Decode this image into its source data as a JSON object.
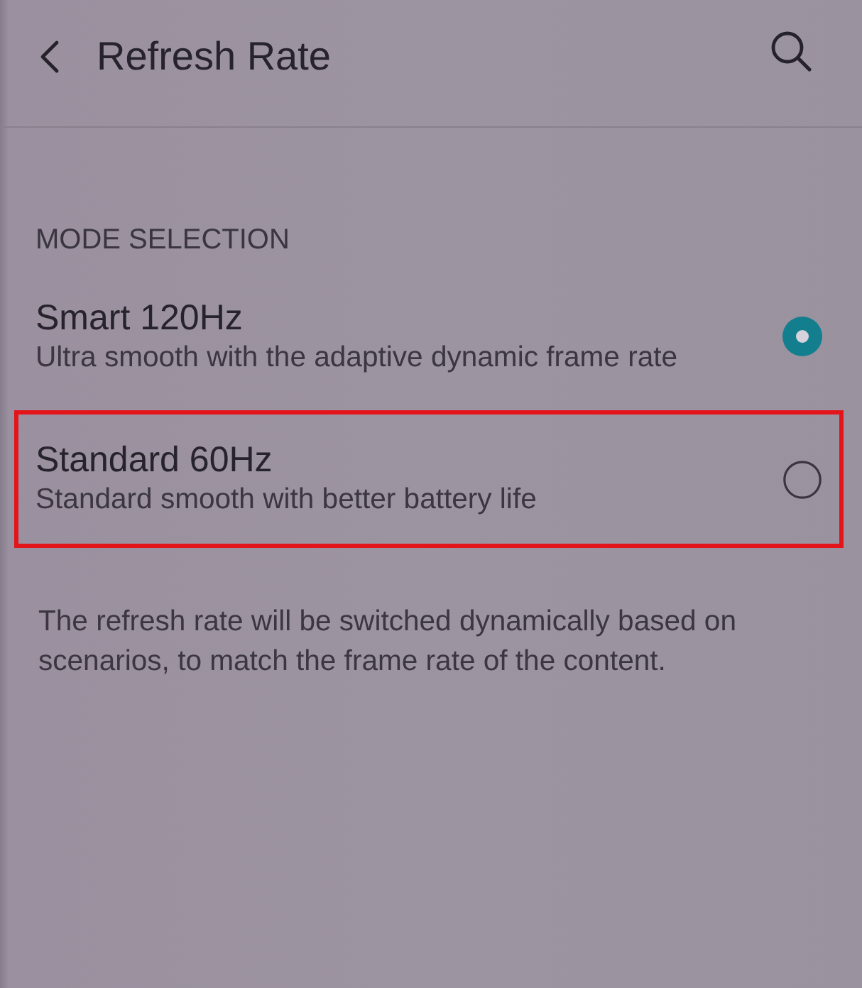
{
  "header": {
    "title": "Refresh Rate"
  },
  "section": {
    "label": "MODE SELECTION"
  },
  "options": [
    {
      "title": "Smart 120Hz",
      "subtitle": "Ultra smooth with the adaptive dynamic frame rate",
      "selected": true,
      "highlighted": false
    },
    {
      "title": "Standard 60Hz",
      "subtitle": "Standard smooth with better battery life",
      "selected": false,
      "highlighted": true
    }
  ],
  "description": "The refresh rate will be switched dynamically based on scenarios, to match the frame rate of the content."
}
